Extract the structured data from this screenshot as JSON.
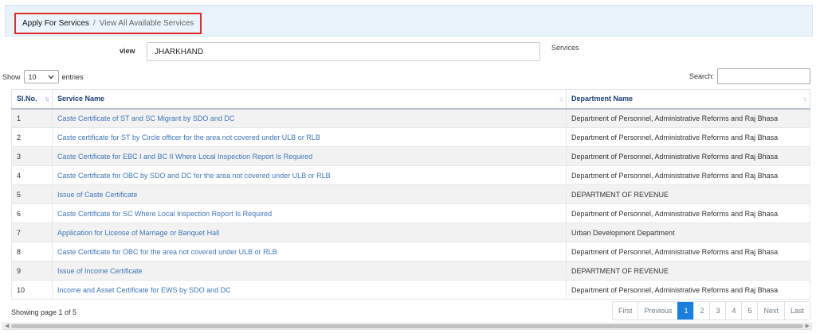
{
  "breadcrumb": {
    "parent": "Apply For Services",
    "separator": "/",
    "current": "View All Available Services"
  },
  "filter": {
    "view_label": "view",
    "state_value": "JHARKHAND",
    "services_label": "Services"
  },
  "controls": {
    "show_label": "Show",
    "length_value": "10",
    "entries_label": "entries",
    "search_label": "Search:"
  },
  "table": {
    "headers": [
      "Sl.No.",
      "Service Name",
      "Department Name"
    ],
    "rows": [
      {
        "sl": "1",
        "service": "Caste Certificate of ST and SC Migrant by SDO and DC",
        "department": "Department of Personnel, Administrative Reforms and Raj Bhasa"
      },
      {
        "sl": "2",
        "service": "Caste certificate for ST by Circle officer for the area not covered under ULB or RLB",
        "department": "Department of Personnel, Administrative Reforms and Raj Bhasa"
      },
      {
        "sl": "3",
        "service": "Caste Certificate for EBC I and BC II Where Local Inspection Report Is Required",
        "department": "Department of Personnel, Administrative Reforms and Raj Bhasa"
      },
      {
        "sl": "4",
        "service": "Caste Certificate for OBC by SDO and DC for the area not covered under ULB or RLB",
        "department": "Department of Personnel, Administrative Reforms and Raj Bhasa"
      },
      {
        "sl": "5",
        "service": "Issue of Caste Certificate",
        "department": "DEPARTMENT OF REVENUE"
      },
      {
        "sl": "6",
        "service": "Caste Certificate for SC Where Local Inspection Report Is Required",
        "department": "Department of Personnel, Administrative Reforms and Raj Bhasa"
      },
      {
        "sl": "7",
        "service": "Application for License of Marriage or Banquet Hall",
        "department": "Urban Development Department"
      },
      {
        "sl": "8",
        "service": "Caste Certificate for OBC for the area not covered under ULB or RLB",
        "department": "Department of Personnel, Administrative Reforms and Raj Bhasa"
      },
      {
        "sl": "9",
        "service": "Issue of Income Certificate",
        "department": "DEPARTMENT OF REVENUE"
      },
      {
        "sl": "10",
        "service": "Income and Asset Certificate for EWS by SDO and DC",
        "department": "Department of Personnel, Administrative Reforms and Raj Bhasa"
      }
    ]
  },
  "footer": {
    "info": "Showing page 1 of 5",
    "first": "First",
    "previous": "Previous",
    "pages": [
      "1",
      "2",
      "3",
      "4",
      "5"
    ],
    "active_page": "1",
    "next": "Next",
    "last": "Last"
  },
  "icons": {
    "sort": "sort-icon",
    "dropdown": "chevron-down-icon",
    "scroll_left": "scroll-left-arrow-icon",
    "scroll_right": "scroll-right-arrow-icon"
  },
  "colors": {
    "breadcrumb_highlight": "#e22b2b",
    "link": "#3d77b8",
    "header_text": "#1c3f78",
    "active_page": "#1a7fe0"
  }
}
